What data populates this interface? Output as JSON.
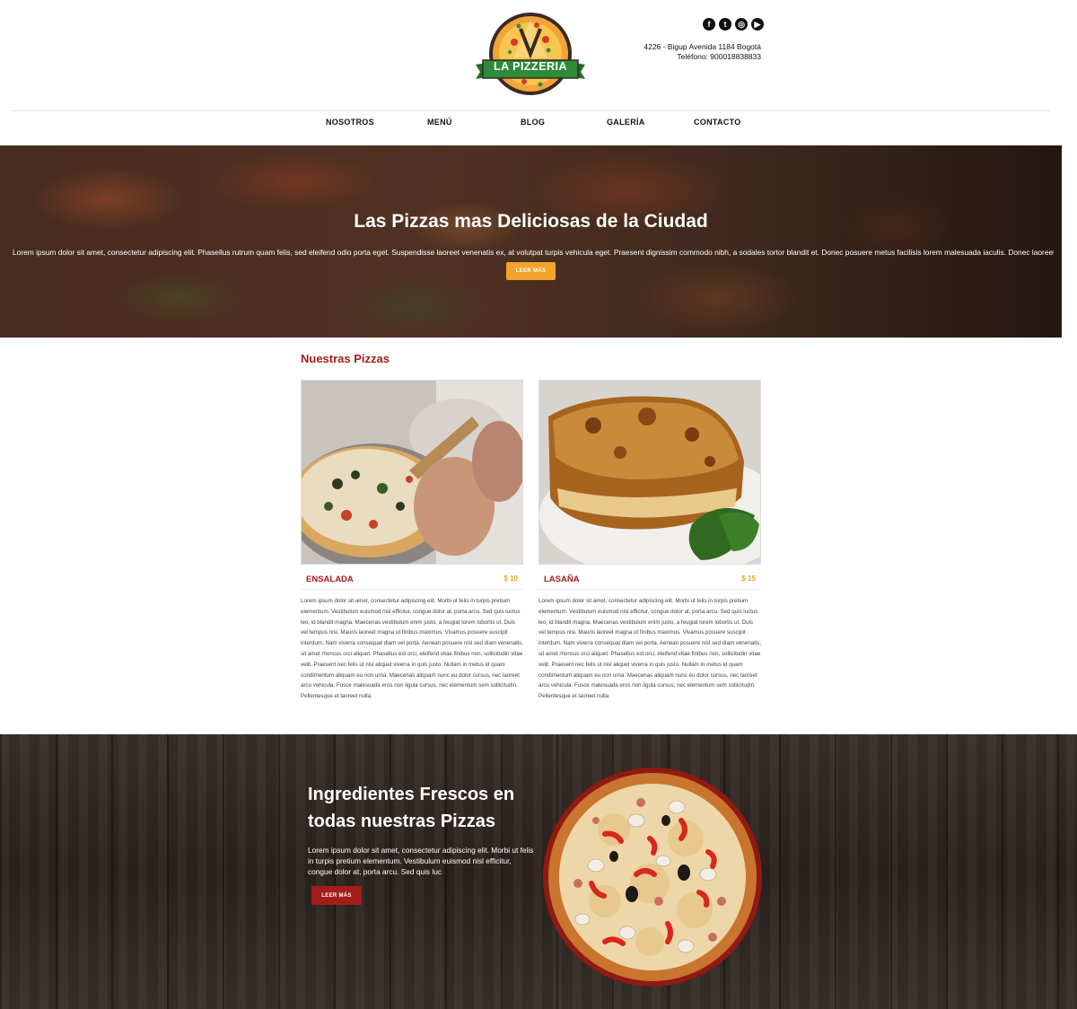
{
  "brand": {
    "logo_text": "LA PIZZERIA"
  },
  "contact": {
    "address": "4226 - Bigup Avenida 1184 Bogotá",
    "phone": "Teléfono: 900018838833"
  },
  "social": [
    {
      "icon": "facebook-icon",
      "glyph": "f"
    },
    {
      "icon": "tumblr-icon",
      "glyph": "t"
    },
    {
      "icon": "instagram-icon",
      "glyph": "◎"
    },
    {
      "icon": "youtube-icon",
      "glyph": "▶"
    }
  ],
  "nav": {
    "items": [
      "NOSOTROS",
      "MENÚ",
      "BLOG",
      "GALERÍA",
      "CONTACTO"
    ]
  },
  "hero": {
    "title": "Las Pizzas mas Deliciosas de la Ciudad",
    "text": "Lorem ipsum dolor sit amet, consectetur adipiscing elit. Phasellus rutrum quam felis, sed eleifend odio porta eget. Suspendisse laoreet venenatis ex, at volutpat turpis vehicula eget. Praesent dignissim commodo nibh, a sodales tortor blandit et. Donec posuere metus facilisis lorem malesuada iaculis. Donec laoreet sem vitae tortor dignissim",
    "button": "LEER MÁS"
  },
  "pizzas": {
    "title": "Nuestras Pizzas",
    "cards": [
      {
        "name": "ENSALADA",
        "price": "$ 10",
        "desc": "Lorem ipsum dolor sit amet, consectetur adipiscing elit. Morbi ut felis in turpis pretium elementum. Vestibulum euismod nisl efficitur, congue dolor at, porta arcu. Sed quis luctus leo, id blandit magna. Maecenas vestibulum enim justo, a feugiat lorem lobortis ut. Duis vel tempus nisi. Mauris laoreet magna ut finibus maximus. Vivamus posuere suscipit interdum. Nam viverra consequat diam vel porta. Aenean posuere nisl sed diam venenatis, sit amet rhoncus orci aliquet. Phasellus est orci, eleifend vitae finibus non, sollicitudin vitae velit. Praesent nec felis ut nisl aliquet viverra in quis justo. Nullam in metus id quam condimentum aliquam eu non urna. Maecenas aliquam nunc eu dolor cursus, nec laoreet arcu vehicula. Fusce malesuada eros non ligula cursus, nec elementum sem sollicitudin. Pellentesque et laoreet nulla."
      },
      {
        "name": "LASAÑA",
        "price": "$ 15",
        "desc": "Lorem ipsum dolor sit amet, consectetur adipiscing elit. Morbi ut felis in turpis pretium elementum. Vestibulum euismod nisl efficitur, congue dolor at, porta arcu. Sed quis luctus leo, id blandit magna. Maecenas vestibulum enim justo, a feugiat lorem lobortis ut. Duis vel tempus nisi. Mauris laoreet magna ut finibus maximus. Vivamus posuere suscipit interdum. Nam viverra consequat diam vel porta. Aenean posuere nisl sed diam venenatis, sit amet rhoncus orci aliquet. Phasellus est orci, eleifend vitae finibus non, sollicitudin vitae velit. Praesent nec felis ut nisl aliquet viverra in quis justo. Nullam in metus id quam condimentum aliquam eu non urna. Maecenas aliquam nunc eu dolor cursus, nec laoreet arcu vehicula. Fusce malesuada eros non ligula cursus, nec elementum sem sollicitudin. Pellentesque et laoreet nulla."
      }
    ]
  },
  "fresh": {
    "title": "Ingredientes Frescos en todas nuestras Pizzas",
    "text": "Lorem ipsum dolor sit amet, consectetur adipiscing elit. Morbi ut felis in turpis pretium elementum. Vestibulum euismod nisl efficitur, congue dolor at, porta arcu. Sed quis luc",
    "button": "LEER MÁS"
  },
  "colors": {
    "brand_red": "#a31c18",
    "accent_orange": "#f0a42a",
    "logo_green": "#2e8b3a"
  }
}
